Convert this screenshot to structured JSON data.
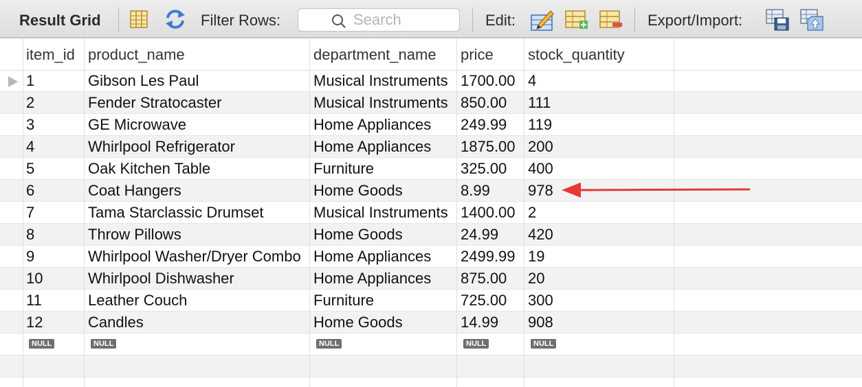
{
  "toolbar": {
    "title": "Result Grid",
    "filter_label": "Filter Rows:",
    "search_placeholder": "Search",
    "edit_label": "Edit:",
    "export_label": "Export/Import:"
  },
  "icons": [
    "grid-layout-icon",
    "refresh-icon",
    "search-icon",
    "edit-cell-icon",
    "add-row-icon",
    "delete-row-icon",
    "export-icon",
    "import-icon",
    "row-pointer-icon",
    "red-arrow-annotation"
  ],
  "colors": {
    "annotation_arrow": "#e53935",
    "toolbar_bg": "#e4e4e4",
    "alt_row": "#f2f2f2"
  },
  "table": {
    "columns": [
      "item_id",
      "product_name",
      "department_name",
      "price",
      "stock_quantity"
    ],
    "rows": [
      [
        "1",
        "Gibson Les Paul",
        "Musical Instruments",
        "1700.00",
        "4"
      ],
      [
        "2",
        "Fender Stratocaster",
        "Musical Instruments",
        "850.00",
        "111"
      ],
      [
        "3",
        "GE Microwave",
        "Home Appliances",
        "249.99",
        "119"
      ],
      [
        "4",
        "Whirlpool Refrigerator",
        "Home Appliances",
        "1875.00",
        "200"
      ],
      [
        "5",
        "Oak Kitchen Table",
        "Furniture",
        "325.00",
        "400"
      ],
      [
        "6",
        "Coat Hangers",
        "Home Goods",
        "8.99",
        "978"
      ],
      [
        "7",
        "Tama Starclassic Drumset",
        "Musical Instruments",
        "1400.00",
        "2"
      ],
      [
        "8",
        "Throw Pillows",
        "Home Goods",
        "24.99",
        "420"
      ],
      [
        "9",
        "Whirlpool Washer/Dryer Combo",
        "Home Appliances",
        "2499.99",
        "19"
      ],
      [
        "10",
        "Whirlpool Dishwasher",
        "Home Appliances",
        "875.00",
        "20"
      ],
      [
        "11",
        "Leather Couch",
        "Furniture",
        "725.00",
        "300"
      ],
      [
        "12",
        "Candles",
        "Home Goods",
        "14.99",
        "908"
      ]
    ],
    "null_label": "NULL"
  }
}
